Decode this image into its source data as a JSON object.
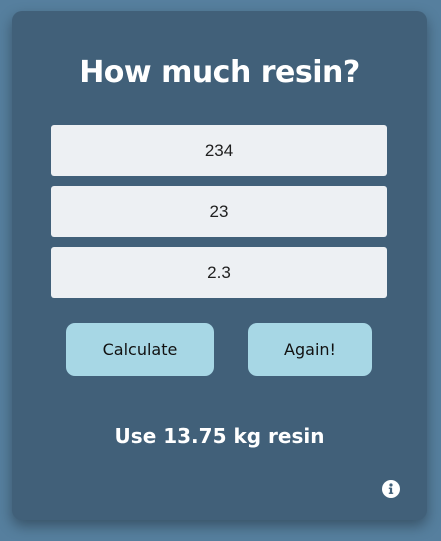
{
  "card": {
    "title": "How much resin?"
  },
  "inputs": [
    {
      "value": "234"
    },
    {
      "value": "23"
    },
    {
      "value": "2.3"
    }
  ],
  "buttons": {
    "calculate_label": "Calculate",
    "again_label": "Again!"
  },
  "result": {
    "text": "Use 13.75 kg resin"
  },
  "icons": {
    "info": "info-icon"
  },
  "colors": {
    "page_background": "#567f9e",
    "card_background": "#416079",
    "button_background": "#a7d7e5",
    "input_background": "#edf0f3"
  }
}
